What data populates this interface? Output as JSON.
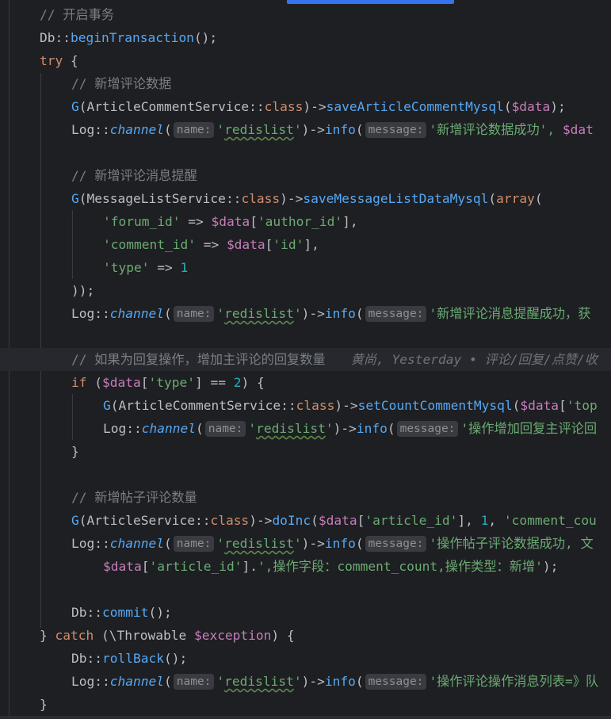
{
  "c_open_tx": "// 开启事务",
  "db": "Db",
  "sep": "::",
  "begin_tx": "beginTransaction",
  "call_end": "();",
  "kw_try": "try",
  "brace_open": " {",
  "c_add_comment": "// 新增评论数据",
  "g": "G",
  "lparen": "(",
  "rparen": ")",
  "arrow": "->",
  "cls_article_comment": "ArticleCommentService",
  "kw_class": "class",
  "save_article_comment": "saveArticleCommentMysql",
  "var_data": "$data",
  "close_call": ");",
  "log": "Log",
  "channel": "channel",
  "hint_name": "name:",
  "str_redislist": "redislist",
  "q": "'",
  "info": "info",
  "hint_message": "message:",
  "str_add_comment_ok": "'新增评论数据成功', ",
  "var_data_cut": "$dat",
  "c_add_msg": "// 新增评论消息提醒",
  "cls_message_list": "MessageListService",
  "save_message_list": "saveMessageListDataMysql",
  "kw_array": "array",
  "str_forum_id": "'forum_id'",
  "fat_arrow": " => ",
  "lbr": "[",
  "rbr": "]",
  "comma": ",",
  "str_author_id": "'author_id'",
  "str_comment_id": "'comment_id'",
  "str_id": "'id'",
  "str_type": "'type'",
  "num_1": "1",
  "close_array": "));",
  "str_add_msg_ok": "'新增评论消息提醒成功，获",
  "c_if_reply": "// 如果为回复操作，增加主评论的回复数量",
  "blame": "黄尚, Yesterday • 评论/回复/点赞/收",
  "kw_if": "if",
  "op_eq": " == ",
  "num_2": "2",
  "set_count": "setCountCommentMysql",
  "str_top_cut": "'top",
  "str_op_reply_cut": "'操作增加回复主评论回",
  "brace_close": "}",
  "c_add_post_count": "// 新增帖子评论数量",
  "cls_article": "ArticleService",
  "do_inc": "doInc",
  "str_article_id": "'article_id'",
  "sep_comma": ", ",
  "str_comment_count_cut": "'comment_cou",
  "str_op_post_cut": "'操作帖子评论数据成功, 文",
  "concat": ".",
  "str_op_field": "',操作字段：comment_count,操作类型：新增'",
  "commit": "commit",
  "catch_open": "} ",
  "kw_catch": "catch",
  "space_lparen": " (",
  "throwable": "\\Throwable",
  "var_exception": "$exception",
  "rollback": "rollBack",
  "str_op_list_cut": "'操作评论操作消息列表=》队"
}
